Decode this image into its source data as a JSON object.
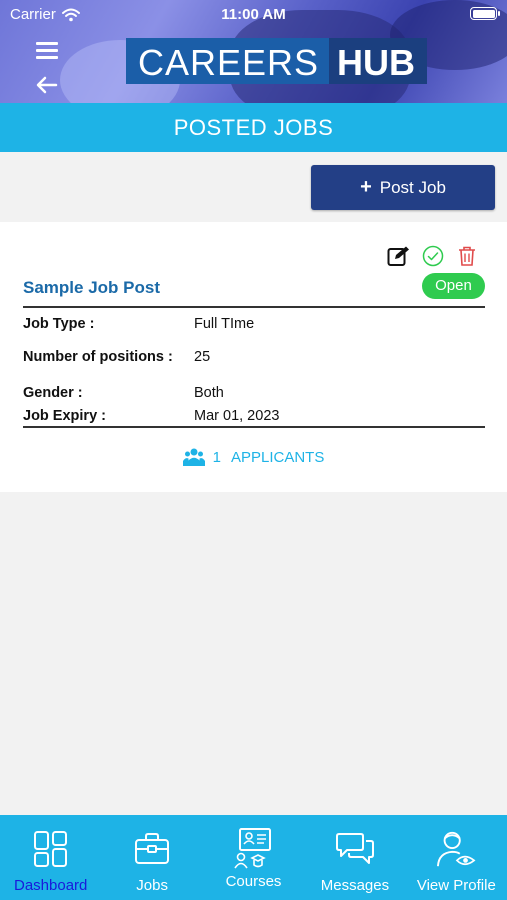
{
  "status_bar": {
    "carrier": "Carrier",
    "time": "11:00 AM"
  },
  "header": {
    "logo_part1": "CAREERS",
    "logo_part2": "HUB",
    "icons": [
      "menu-icon",
      "back-arrow-icon"
    ]
  },
  "page": {
    "title": "POSTED JOBS"
  },
  "actions": {
    "post_job_label": "Post Job"
  },
  "job": {
    "title": "Sample Job Post",
    "status": "Open",
    "action_icons": [
      "edit-icon",
      "check-circle-icon",
      "trash-icon"
    ],
    "details": [
      {
        "label": "Job Type :",
        "value": "Full TIme"
      },
      {
        "label": "Number of positions :",
        "value": "25"
      },
      {
        "label": "Gender :",
        "value": "Both"
      },
      {
        "label": "Job Expiry :",
        "value": "Mar 01, 2023"
      }
    ],
    "applicants_count": "1",
    "applicants_label": "APPLICANTS"
  },
  "tabbar": {
    "items": [
      {
        "label": "Dashboard",
        "icon": "dashboard-icon",
        "active": true
      },
      {
        "label": "Jobs",
        "icon": "briefcase-icon"
      },
      {
        "label": "Courses",
        "icon": "courses-icon"
      },
      {
        "label": "Messages",
        "icon": "chat-bubbles-icon"
      },
      {
        "label": "View Profile",
        "icon": "profile-icon"
      }
    ]
  },
  "colors": {
    "primary": "#1eb3e6",
    "post_button": "#233f86",
    "job_title": "#1b6aa8",
    "status_open": "#2fcb4f",
    "active_tab": "#1a1adb",
    "delete": "#e04b4b",
    "approve": "#2fcb4f"
  }
}
